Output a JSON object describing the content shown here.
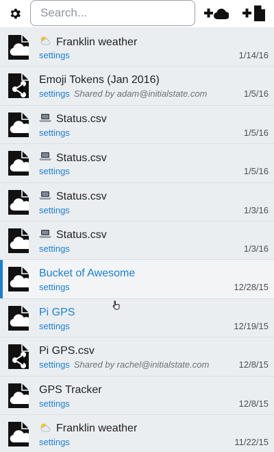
{
  "toolbar": {
    "settings_icon": "gear-icon",
    "search_placeholder": "Search...",
    "add_bucket_icon": "plus-cloud-icon",
    "add_file_icon": "plus-file-icon"
  },
  "colors": {
    "accent": "#1a7fd6",
    "row_bg": "#ebeef1",
    "active_row_bg": "#f2f4f6"
  },
  "items": [
    {
      "icon": "cloud-file-icon",
      "emoji": "sun-cloud-icon",
      "title": "Franklin weather",
      "settings": "settings",
      "shared": "",
      "date": "1/14/16",
      "highlighted": false
    },
    {
      "icon": "share-file-icon",
      "emoji": "",
      "title": "Emoji Tokens (Jan 2016)",
      "settings": "settings",
      "shared": "Shared by adam@initialstate.com",
      "date": "1/5/16",
      "highlighted": false
    },
    {
      "icon": "cloud-file-icon",
      "emoji": "laptop-icon",
      "title": "Status.csv",
      "settings": "settings",
      "shared": "",
      "date": "1/5/16",
      "highlighted": false
    },
    {
      "icon": "cloud-file-icon",
      "emoji": "laptop-icon",
      "title": "Status.csv",
      "settings": "settings",
      "shared": "",
      "date": "1/5/16",
      "highlighted": false
    },
    {
      "icon": "cloud-file-icon",
      "emoji": "laptop-icon",
      "title": "Status.csv",
      "settings": "settings",
      "shared": "",
      "date": "1/3/16",
      "highlighted": false
    },
    {
      "icon": "cloud-file-icon",
      "emoji": "laptop-icon",
      "title": "Status.csv",
      "settings": "settings",
      "shared": "",
      "date": "1/3/16",
      "highlighted": false
    },
    {
      "icon": "cloud-file-icon",
      "emoji": "",
      "title": "Bucket of Awesome",
      "settings": "settings",
      "shared": "",
      "date": "12/28/15",
      "highlighted": true,
      "active": true
    },
    {
      "icon": "cloud-file-icon",
      "emoji": "",
      "title": "Pi GPS",
      "settings": "settings",
      "shared": "",
      "date": "12/19/15",
      "highlighted": true,
      "active": false
    },
    {
      "icon": "share-file-icon",
      "emoji": "",
      "title": "Pi GPS.csv",
      "settings": "settings",
      "shared": "Shared by rachel@initialstate.com",
      "date": "12/8/15",
      "highlighted": false
    },
    {
      "icon": "cloud-file-icon",
      "emoji": "",
      "title": "GPS Tracker",
      "settings": "settings",
      "shared": "",
      "date": "12/8/15",
      "highlighted": false
    },
    {
      "icon": "cloud-file-icon",
      "emoji": "sun-cloud-icon",
      "title": "Franklin weather",
      "settings": "settings",
      "shared": "",
      "date": "11/22/15",
      "highlighted": false
    }
  ]
}
